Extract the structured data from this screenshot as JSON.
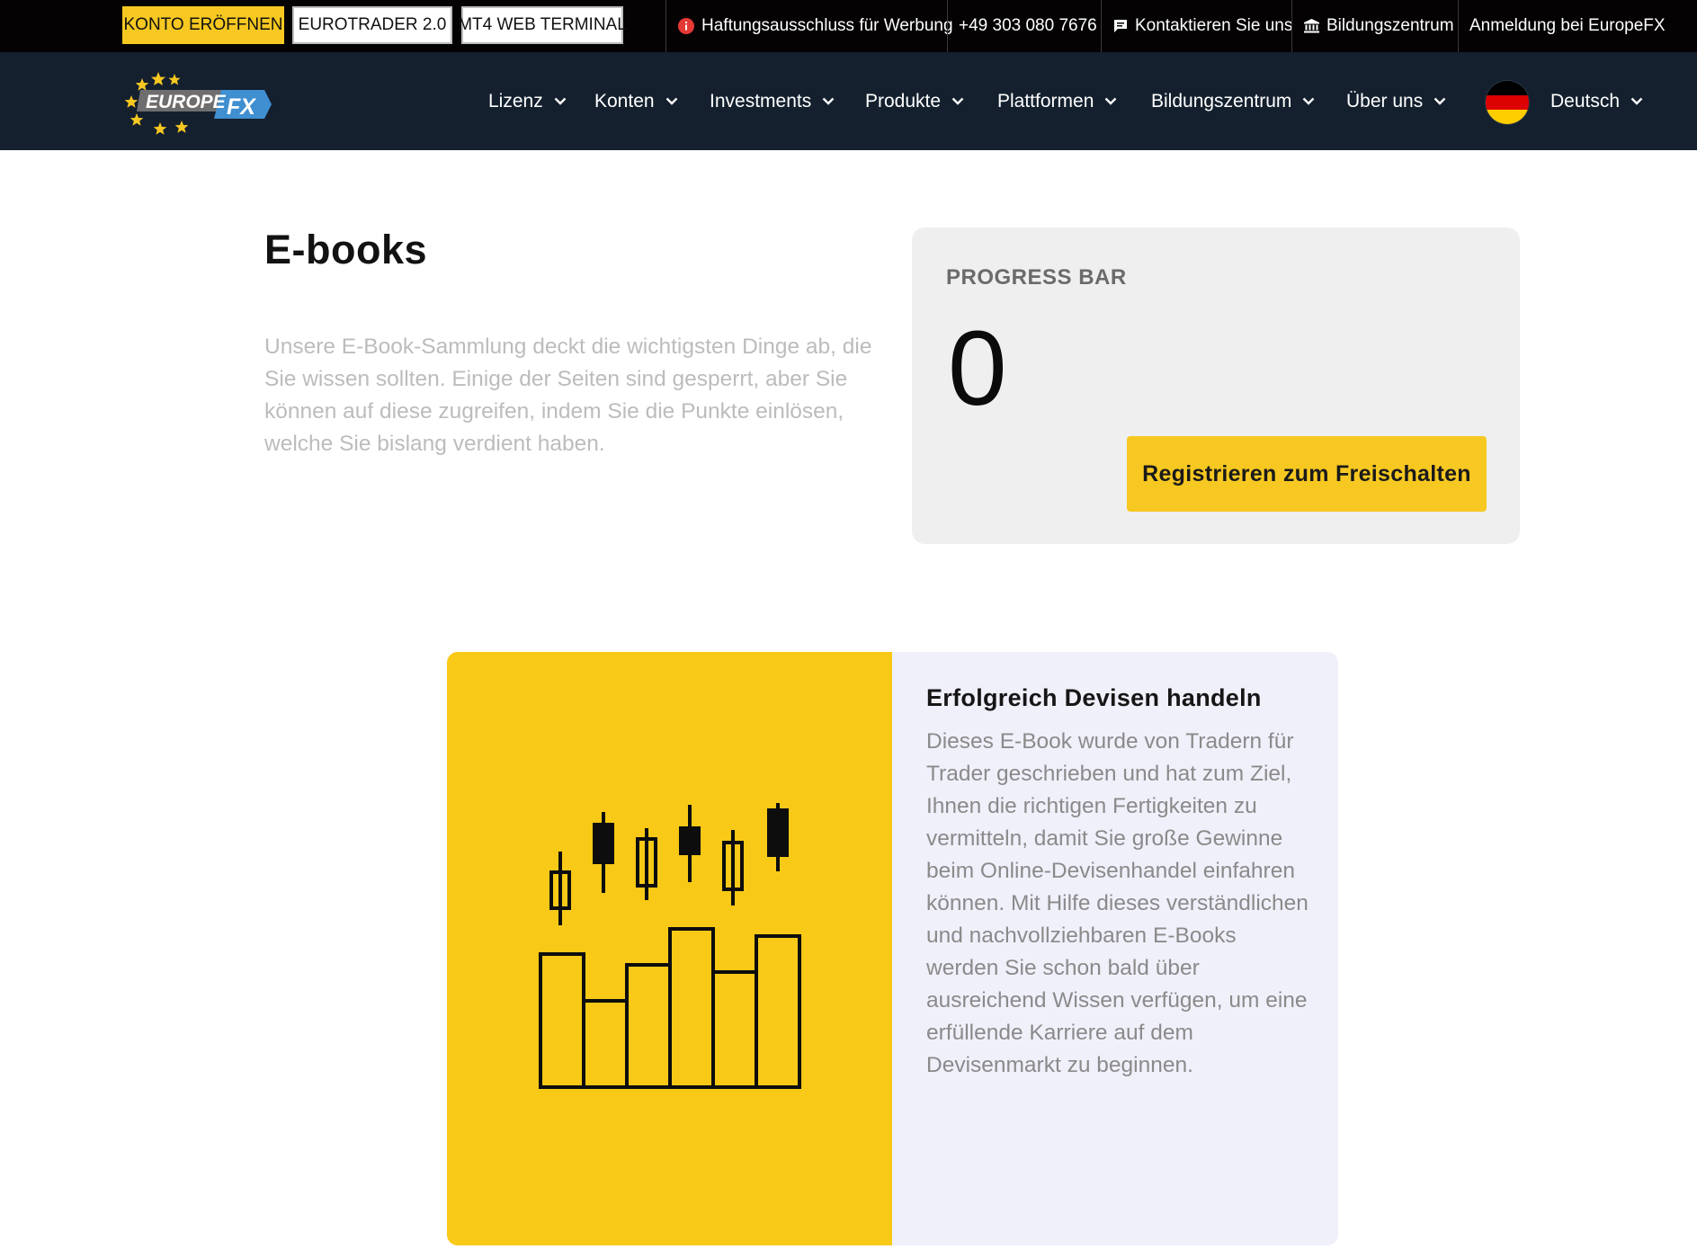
{
  "topbar": {
    "open_account": "KONTO ERÖFFNEN",
    "eurotrader": "EUROTRADER 2.0",
    "mt4": "MT4 WEB TERMINAL",
    "disclaimer": "Haftungsausschluss für Werbung",
    "phone": "+49 303 080 7676",
    "contact": "Kontaktieren Sie uns",
    "education": "Bildungszentrum",
    "login": "Anmeldung bei EuropeFX"
  },
  "logo": {
    "text_left": "EUROPE",
    "text_right": "FX"
  },
  "nav": {
    "items": [
      {
        "label": "Lizenz"
      },
      {
        "label": "Konten"
      },
      {
        "label": "Investments"
      },
      {
        "label": "Produkte"
      },
      {
        "label": "Plattformen"
      },
      {
        "label": "Bildungszentrum"
      },
      {
        "label": "Über uns"
      }
    ],
    "language": "Deutsch"
  },
  "page": {
    "title": "E-books",
    "intro": "Unsere E-Book-Sammlung deckt die wichtigsten Dinge ab, die Sie wissen sollten. Einige der Seiten sind gesperrt, aber Sie können auf diese zugreifen, indem Sie die Punkte einlösen, welche Sie bislang verdient haben."
  },
  "progress": {
    "label": "PROGRESS BAR",
    "value": "0",
    "button": "Registrieren zum Freischalten"
  },
  "ebook": {
    "title": "Erfolgreich Devisen handeln",
    "description": "Dieses E-Book wurde von Tradern für Trader geschrieben und hat zum Ziel, Ihnen die richtigen Fertigkeiten zu vermitteln, damit Sie große Gewinne beim Online-Devisenhandel einfahren können. Mit Hilfe dieses verständlichen und nachvollziehbaren E-Books werden Sie schon bald über ausreichend Wissen verfügen, um eine erfüllende Karriere auf dem Devisenmarkt zu beginnen.",
    "illustration": "candlestick-bar-chart-icon"
  },
  "colors": {
    "accent_yellow": "#f7c821",
    "topbar_bg": "#050203",
    "navbar_bg": "#14202e",
    "card_bg": "#f0f0fb",
    "progress_card_bg": "#efefef"
  }
}
